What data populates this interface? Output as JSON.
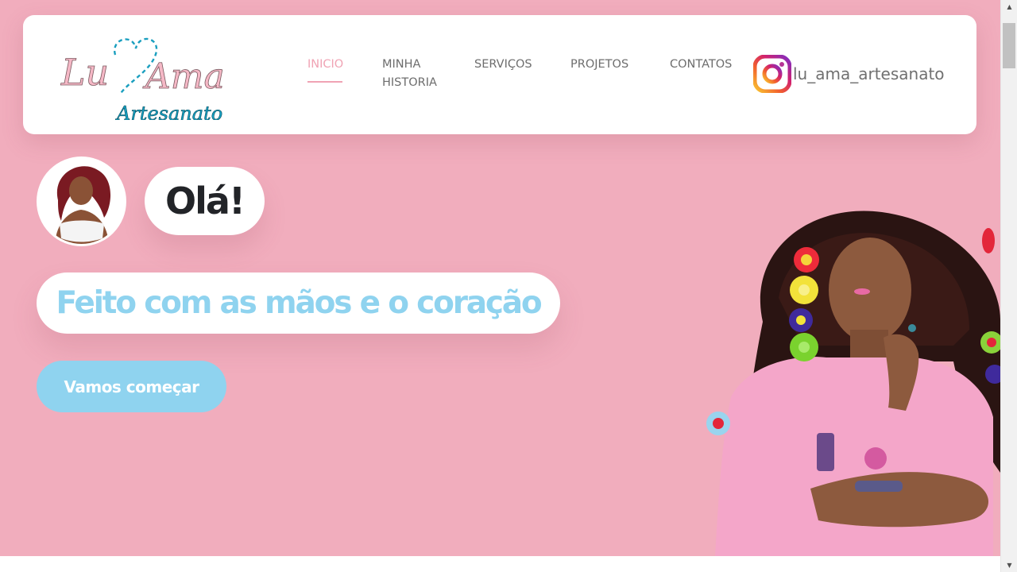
{
  "brand": {
    "logo_line1": "Lu",
    "logo_line2": "Ama",
    "logo_line3": "Artesanato",
    "colors": {
      "pink": "#f0a3b4",
      "blue": "#1aa0c8",
      "background": "#f1adbd"
    }
  },
  "nav": {
    "items": [
      {
        "label": "INICIO",
        "active": true
      },
      {
        "label": "MINHA HISTORIA",
        "active": false
      },
      {
        "label": "SERVIÇOS",
        "active": false
      },
      {
        "label": "PROJETOS",
        "active": false
      },
      {
        "label": "CONTATOS",
        "active": false
      }
    ]
  },
  "social": {
    "icon": "instagram-icon",
    "handle": "lu_ama_artesanato"
  },
  "hero": {
    "greeting": "Olá!",
    "tagline": "Feito com as mãos e o coração",
    "cta_label": "Vamos começar",
    "colors": {
      "accent": "#8fd3ef",
      "greeting_text": "#222428"
    }
  }
}
